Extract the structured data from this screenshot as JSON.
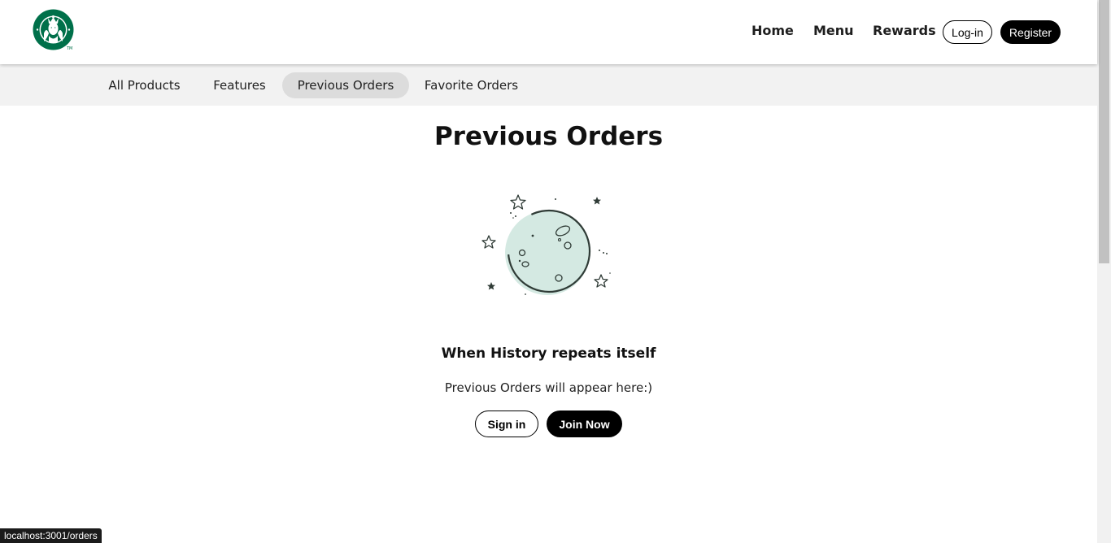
{
  "header": {
    "nav": [
      {
        "label": "Home"
      },
      {
        "label": "Menu"
      },
      {
        "label": "Rewards"
      }
    ],
    "login_label": "Log-in",
    "register_label": "Register"
  },
  "subnav": {
    "tabs": [
      {
        "label": "All Products",
        "active": false
      },
      {
        "label": "Features",
        "active": false
      },
      {
        "label": "Previous Orders",
        "active": true
      },
      {
        "label": "Favorite Orders",
        "active": false
      }
    ]
  },
  "main": {
    "title": "Previous Orders",
    "illustration": "moon-stars-illustration",
    "subtitle": "When History repeats itself",
    "description": "Previous Orders will appear here:)",
    "signin_label": "Sign in",
    "join_label": "Join Now"
  },
  "statusbar": {
    "url": "localhost:3001/orders"
  },
  "colors": {
    "brand_green": "#00704a",
    "moon_fill": "#d4e9e2",
    "subnav_bg": "#f2f2f2",
    "active_tab_bg": "#dcdcdc"
  }
}
